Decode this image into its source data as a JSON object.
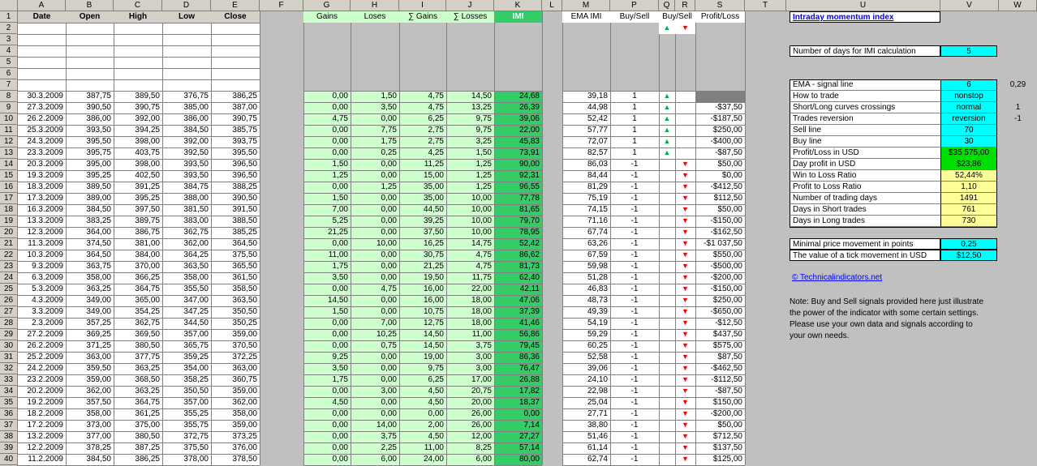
{
  "columns": [
    "A",
    "B",
    "C",
    "D",
    "E",
    "F",
    "G",
    "H",
    "I",
    "J",
    "K",
    "L",
    "M",
    "N",
    "O",
    "P",
    "Q",
    "R",
    "S",
    "T",
    "U",
    "V",
    "W"
  ],
  "header_row": {
    "date": "Date",
    "open": "Open",
    "high": "High",
    "low": "Low",
    "close": "Close",
    "gains": "Gains",
    "loses": "Loses",
    "sum_gains": "∑ Gains",
    "sum_losses": "∑ Losses",
    "imi": "IMI",
    "ema_imi": "EMA IMI",
    "buy_sell_p": "Buy/Sell",
    "buy_sell_qr": "Buy/Sell",
    "profit_loss": "Profit/Loss"
  },
  "row_numbers": [
    "1",
    "2",
    "3",
    "4",
    "5",
    "6",
    "7",
    "8",
    "9",
    "10",
    "11",
    "12",
    "13",
    "14",
    "15",
    "16",
    "17",
    "18",
    "19",
    "20",
    "21",
    "22",
    "23",
    "24",
    "25",
    "26",
    "27",
    "28",
    "29",
    "30",
    "31",
    "32",
    "33",
    "34",
    "35",
    "36",
    "37",
    "38",
    "39",
    "40"
  ],
  "legend_arrows": {
    "up": "▲",
    "down": "▼"
  },
  "rows": [
    [
      "30.3.2009",
      "387,75",
      "389,50",
      "376,75",
      "386,25",
      "0,00",
      "1,50",
      "4,75",
      "14,50",
      "24,68",
      "39,18",
      "1",
      "up",
      ""
    ],
    [
      "27.3.2009",
      "390,50",
      "390,75",
      "385,00",
      "387,00",
      "0,00",
      "3,50",
      "4,75",
      "13,25",
      "26,39",
      "44,98",
      "1",
      "up",
      "-$37,50"
    ],
    [
      "26.2.2009",
      "386,00",
      "392,00",
      "386,00",
      "390,75",
      "4,75",
      "0,00",
      "6,25",
      "9,75",
      "39,06",
      "52,42",
      "1",
      "up",
      "-$187,50"
    ],
    [
      "25.3.2009",
      "393,50",
      "394,25",
      "384,50",
      "385,75",
      "0,00",
      "7,75",
      "2,75",
      "9,75",
      "22,00",
      "57,77",
      "1",
      "up",
      "$250,00"
    ],
    [
      "24.3.2009",
      "395,50",
      "398,00",
      "392,00",
      "393,75",
      "0,00",
      "1,75",
      "2,75",
      "3,25",
      "45,83",
      "72,07",
      "1",
      "up",
      "-$400,00"
    ],
    [
      "23.3.2009",
      "395,75",
      "403,75",
      "392,50",
      "395,50",
      "0,00",
      "0,25",
      "4,25",
      "1,50",
      "73,91",
      "82,57",
      "1",
      "up",
      "-$87,50"
    ],
    [
      "20.3.2009",
      "395,00",
      "398,00",
      "393,50",
      "396,50",
      "1,50",
      "0,00",
      "11,25",
      "1,25",
      "90,00",
      "86,03",
      "-1",
      "down",
      "$50,00"
    ],
    [
      "19.3.2009",
      "395,25",
      "402,50",
      "393,50",
      "396,50",
      "1,25",
      "0,00",
      "15,00",
      "1,25",
      "92,31",
      "84,44",
      "-1",
      "down",
      "$0,00"
    ],
    [
      "18.3.2009",
      "389,50",
      "391,25",
      "384,75",
      "388,25",
      "0,00",
      "1,25",
      "35,00",
      "1,25",
      "96,55",
      "81,29",
      "-1",
      "down",
      "-$412,50"
    ],
    [
      "17.3.2009",
      "389,00",
      "395,25",
      "388,00",
      "390,50",
      "1,50",
      "0,00",
      "35,00",
      "10,00",
      "77,78",
      "75,19",
      "-1",
      "down",
      "$112,50"
    ],
    [
      "16.3.2009",
      "384,50",
      "397,50",
      "381,50",
      "391,50",
      "7,00",
      "0,00",
      "44,50",
      "10,00",
      "81,65",
      "74,15",
      "-1",
      "down",
      "$50,00"
    ],
    [
      "13.3.2009",
      "383,25",
      "389,75",
      "383,00",
      "388,50",
      "5,25",
      "0,00",
      "39,25",
      "10,00",
      "79,70",
      "71,16",
      "-1",
      "down",
      "-$150,00"
    ],
    [
      "12.3.2009",
      "364,00",
      "386,75",
      "362,75",
      "385,25",
      "21,25",
      "0,00",
      "37,50",
      "10,00",
      "78,95",
      "67,74",
      "-1",
      "down",
      "-$162,50"
    ],
    [
      "11.3.2009",
      "374,50",
      "381,00",
      "362,00",
      "364,50",
      "0,00",
      "10,00",
      "16,25",
      "14,75",
      "52,42",
      "63,26",
      "-1",
      "down",
      "-$1 037,50"
    ],
    [
      "10.3.2009",
      "364,50",
      "384,00",
      "364,25",
      "375,50",
      "11,00",
      "0,00",
      "30,75",
      "4,75",
      "86,62",
      "67,59",
      "-1",
      "down",
      "$550,00"
    ],
    [
      "9.3.2009",
      "363,75",
      "370,00",
      "363,50",
      "365,50",
      "1,75",
      "0,00",
      "21,25",
      "4,75",
      "81,73",
      "59,98",
      "-1",
      "down",
      "-$500,00"
    ],
    [
      "6.3.2009",
      "358,00",
      "366,25",
      "358,00",
      "361,50",
      "3,50",
      "0,00",
      "19,50",
      "11,75",
      "62,40",
      "51,28",
      "-1",
      "down",
      "-$200,00"
    ],
    [
      "5.3.2009",
      "363,25",
      "364,75",
      "355,50",
      "358,50",
      "0,00",
      "4,75",
      "16,00",
      "22,00",
      "42,11",
      "46,83",
      "-1",
      "down",
      "-$150,00"
    ],
    [
      "4.3.2009",
      "349,00",
      "365,00",
      "347,00",
      "363,50",
      "14,50",
      "0,00",
      "16,00",
      "18,00",
      "47,06",
      "48,73",
      "-1",
      "down",
      "$250,00"
    ],
    [
      "3.3.2009",
      "349,00",
      "354,25",
      "347,25",
      "350,50",
      "1,50",
      "0,00",
      "10,75",
      "18,00",
      "37,39",
      "49,39",
      "-1",
      "down",
      "-$650,00"
    ],
    [
      "2.3.2009",
      "357,25",
      "362,75",
      "344,50",
      "350,25",
      "0,00",
      "7,00",
      "12,75",
      "18,00",
      "41,46",
      "54,19",
      "-1",
      "down",
      "-$12,50"
    ],
    [
      "27.2.2009",
      "369,25",
      "369,50",
      "357,00",
      "359,00",
      "0,00",
      "10,25",
      "14,50",
      "11,00",
      "56,86",
      "59,29",
      "-1",
      "down",
      "$437,50"
    ],
    [
      "26.2.2009",
      "371,25",
      "380,50",
      "365,75",
      "370,50",
      "0,00",
      "0,75",
      "14,50",
      "3,75",
      "79,45",
      "60,25",
      "-1",
      "down",
      "$575,00"
    ],
    [
      "25.2.2009",
      "363,00",
      "377,75",
      "359,25",
      "372,25",
      "9,25",
      "0,00",
      "19,00",
      "3,00",
      "86,36",
      "52,58",
      "-1",
      "down",
      "$87,50"
    ],
    [
      "24.2.2009",
      "359,50",
      "363,25",
      "354,00",
      "363,00",
      "3,50",
      "0,00",
      "9,75",
      "3,00",
      "76,47",
      "39,06",
      "-1",
      "down",
      "-$462,50"
    ],
    [
      "23.2.2009",
      "359,00",
      "368,50",
      "358,25",
      "360,75",
      "1,75",
      "0,00",
      "6,25",
      "17,00",
      "26,88",
      "24,10",
      "-1",
      "down",
      "-$112,50"
    ],
    [
      "20.2.2009",
      "362,00",
      "363,25",
      "350,50",
      "359,00",
      "0,00",
      "3,00",
      "4,50",
      "20,75",
      "17,82",
      "22,98",
      "-1",
      "down",
      "-$87,50"
    ],
    [
      "19.2.2009",
      "357,50",
      "364,75",
      "357,00",
      "362,00",
      "4,50",
      "0,00",
      "4,50",
      "20,00",
      "18,37",
      "25,04",
      "-1",
      "down",
      "$150,00"
    ],
    [
      "18.2.2009",
      "358,00",
      "361,25",
      "355,25",
      "358,00",
      "0,00",
      "0,00",
      "0,00",
      "26,00",
      "0,00",
      "27,71",
      "-1",
      "down",
      "-$200,00"
    ],
    [
      "17.2.2009",
      "373,00",
      "375,00",
      "355,75",
      "359,00",
      "0,00",
      "14,00",
      "2,00",
      "26,00",
      "7,14",
      "38,80",
      "-1",
      "down",
      "$50,00"
    ],
    [
      "13.2.2009",
      "377,00",
      "380,50",
      "372,75",
      "373,25",
      "0,00",
      "3,75",
      "4,50",
      "12,00",
      "27,27",
      "51,46",
      "-1",
      "down",
      "$712,50"
    ],
    [
      "12.2.2009",
      "378,25",
      "387,25",
      "375,50",
      "376,00",
      "0,00",
      "2,25",
      "11,00",
      "8,25",
      "57,14",
      "61,14",
      "-1",
      "down",
      "$137,50"
    ],
    [
      "11.2.2009",
      "384,50",
      "386,25",
      "378,00",
      "378,50",
      "0,00",
      "6,00",
      "24,00",
      "6,00",
      "80,00",
      "62,74",
      "-1",
      "down",
      "$125,00"
    ]
  ],
  "panel": {
    "title": "Intraday momentum index",
    "days_label": "Number of days for IMI calculation",
    "days_value": "5",
    "params": [
      {
        "label": "EMA - signal line",
        "value": "6",
        "w": "0,29",
        "color": "#00ffff"
      },
      {
        "label": "How to trade",
        "value": "nonstop",
        "w": "",
        "color": "#00ffff"
      },
      {
        "label": "Short/Long curves crossings",
        "value": "normal",
        "w": "1",
        "color": "#00ffff"
      },
      {
        "label": "Trades reversion",
        "value": "reversion",
        "w": "-1",
        "color": "#00ffff"
      },
      {
        "label": "Sell line",
        "value": "70",
        "w": "",
        "color": "#00ffff"
      },
      {
        "label": "Buy line",
        "value": "30",
        "w": "",
        "color": "#00ffff"
      },
      {
        "label": "Profit/Loss in USD",
        "value": "$35 575,00",
        "w": "",
        "color": "#00e000"
      },
      {
        "label": "Day profit in USD",
        "value": "$23,86",
        "w": "",
        "color": "#00e000"
      },
      {
        "label": "Win to Loss Ratio",
        "value": "52,44%",
        "w": "",
        "color": "#ffff99"
      },
      {
        "label": "Profit to Loss Ratio",
        "value": "1,10",
        "w": "",
        "color": "#ffff99"
      },
      {
        "label": "Number of trading days",
        "value": "1491",
        "w": "",
        "color": "#ffff99"
      },
      {
        "label": "Days in Short trades",
        "value": "761",
        "w": "",
        "color": "#ffff99"
      },
      {
        "label": "Days in Long trades",
        "value": "730",
        "w": "",
        "color": "#ffff99"
      }
    ],
    "tick_params": [
      {
        "label": "Minimal price movement in points",
        "value": "0,25"
      },
      {
        "label": "The value of a tick movement in USD",
        "value": "$12,50"
      }
    ],
    "link": "© Technicalindicators.net",
    "note": "Note: Buy and Sell signals provided here just illustrate the power of the indicator with some certain settings. Please use your own data and signals according to your own needs."
  },
  "colors": {
    "white": "#ffffff",
    "grey": "#c0c0c0",
    "light_green": "#ccffcc",
    "imi_green": "#33cc66",
    "cyan": "#00ffff",
    "yellow": "#ffff99",
    "header_bg": "#d4d0c8"
  }
}
